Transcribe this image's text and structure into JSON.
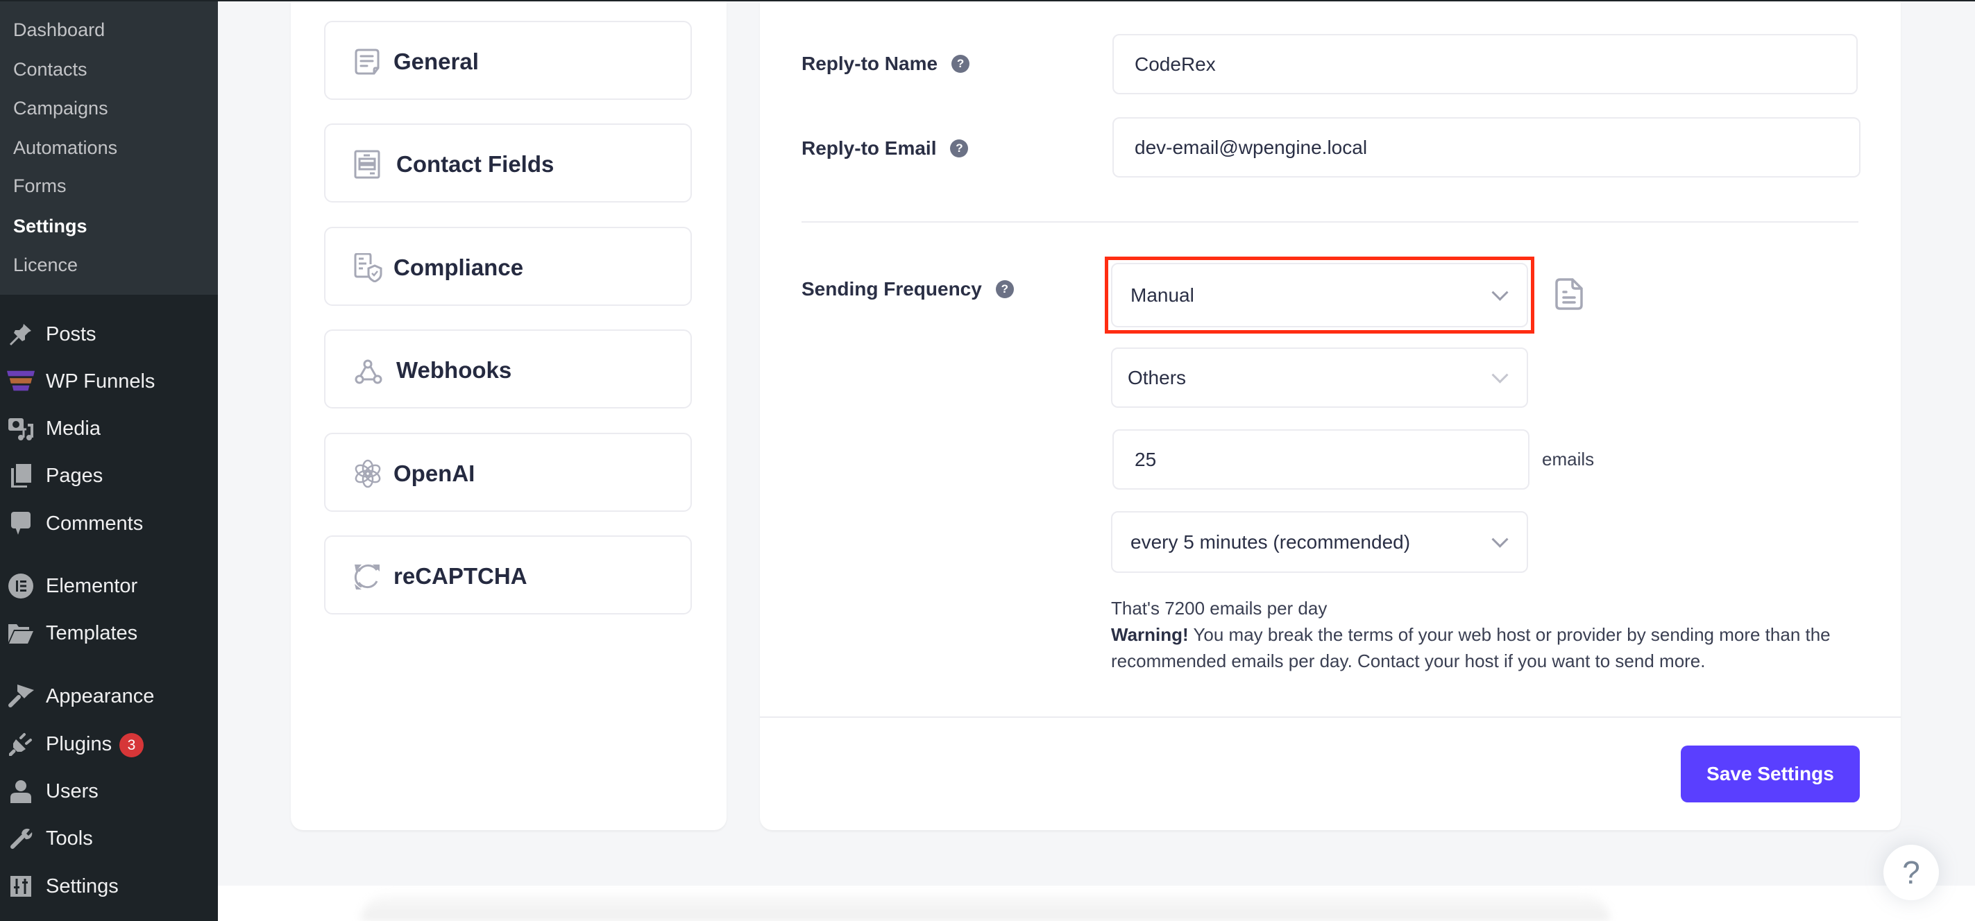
{
  "sidebar": {
    "submenu": [
      {
        "label": "Dashboard",
        "active": false
      },
      {
        "label": "Contacts",
        "active": false
      },
      {
        "label": "Campaigns",
        "active": false
      },
      {
        "label": "Automations",
        "active": false
      },
      {
        "label": "Forms",
        "active": false
      },
      {
        "label": "Settings",
        "active": true
      },
      {
        "label": "Licence",
        "active": false
      }
    ],
    "menu": [
      {
        "label": "Posts",
        "icon": "pin-icon"
      },
      {
        "label": "WP Funnels",
        "icon": "funnel-icon"
      },
      {
        "label": "Media",
        "icon": "media-icon"
      },
      {
        "label": "Pages",
        "icon": "pages-icon"
      },
      {
        "label": "Comments",
        "icon": "comment-icon"
      },
      {
        "label": "Elementor",
        "icon": "elementor-icon"
      },
      {
        "label": "Templates",
        "icon": "folder-icon"
      },
      {
        "label": "Appearance",
        "icon": "brush-icon"
      },
      {
        "label": "Plugins",
        "icon": "plugin-icon",
        "badge": "3"
      },
      {
        "label": "Users",
        "icon": "user-icon"
      },
      {
        "label": "Tools",
        "icon": "wrench-icon"
      },
      {
        "label": "Settings",
        "icon": "sliders-icon"
      }
    ]
  },
  "settings_nav": {
    "items": [
      {
        "label": "General",
        "icon": "document-icon"
      },
      {
        "label": "Contact Fields",
        "icon": "form-fields-icon"
      },
      {
        "label": "Compliance",
        "icon": "shield-document-icon"
      },
      {
        "label": "Webhooks",
        "icon": "webhook-icon"
      },
      {
        "label": "OpenAI",
        "icon": "openai-icon"
      },
      {
        "label": "reCAPTCHA",
        "icon": "recaptcha-icon"
      }
    ]
  },
  "form": {
    "reply_to_name": {
      "label": "Reply-to Name",
      "value": "CodeRex",
      "help": "?"
    },
    "reply_to_email": {
      "label": "Reply-to Email",
      "value": "dev-email@wpengine.local",
      "help": "?"
    },
    "sending_frequency": {
      "label": "Sending Frequency",
      "help": "?",
      "mode": "Manual",
      "preset": "Others",
      "emails_count": "25",
      "emails_unit": "emails",
      "interval": "every 5 minutes (recommended)",
      "daily_total_text": "That's 7200 emails per day",
      "warning_title": "Warning!",
      "warning_text": " You may break the terms of your web host or provider by sending more than the recommended emails per day. Contact your host if you want to send more."
    },
    "save_label": "Save Settings"
  },
  "help_fab": "?",
  "colors": {
    "accent": "#5a3fff",
    "highlight": "#ff2d12",
    "badge": "#d63638",
    "sidebar": "#1d2327",
    "submenu": "#2c3338"
  }
}
